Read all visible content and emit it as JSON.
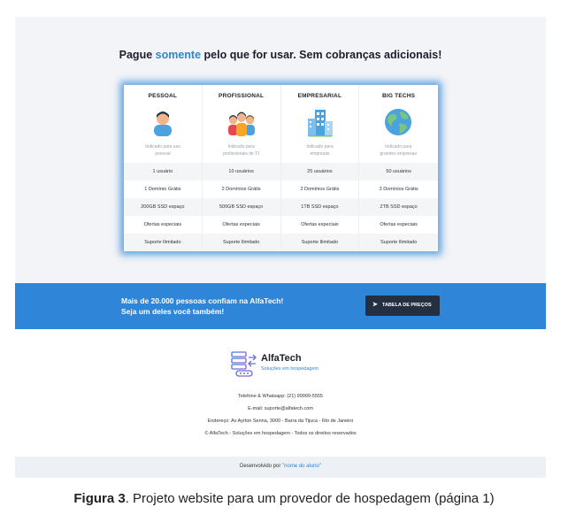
{
  "headline": {
    "part1": "Pague ",
    "highlight": "somente",
    "part2": " pelo que for usar. Sem cobranças adicionais!"
  },
  "plans": [
    {
      "name": "PESSOAL",
      "icon": "person-icon",
      "desc1": "Indicado para uso",
      "desc2": "pessoal",
      "features": [
        "1 usuário",
        "1 Domínio Grátis",
        "200GB SSD espaço",
        "Ofertas especiais",
        "Suporte Ilimitado"
      ]
    },
    {
      "name": "PROFISSIONAL",
      "icon": "team-icon",
      "desc1": "Indicado para",
      "desc2": "profissionais de T.I",
      "features": [
        "10 usuários",
        "2 Domínios Grátis",
        "500GB SSD espaço",
        "Ofertas especiais",
        "Suporte Ilimitado"
      ]
    },
    {
      "name": "EMPRESARIAL",
      "icon": "buildings-icon",
      "desc1": "Indicado para",
      "desc2": "empresas",
      "features": [
        "25 usuários",
        "2 Domínios Grátis",
        "1TB SSD espaço",
        "Ofertas especiais",
        "Suporte Ilimitado"
      ]
    },
    {
      "name": "BIG TECHS",
      "icon": "globe-icon",
      "desc1": "Indicado para",
      "desc2": "grandes empresas",
      "features": [
        "50 usuários",
        "3 Domínios Grátis",
        "2TB SSD espaço",
        "Ofertas especiais",
        "Suporte Ilimitado"
      ]
    }
  ],
  "banner": {
    "line1": "Mais de 20.000 pessoas confiam na AlfaTech!",
    "line2": "Seja um deles você também!",
    "button": "TABELA DE PREÇOS"
  },
  "footer": {
    "brand": "AlfaTech",
    "tagline": "Soluções em hospedagem",
    "phone": "Telefone & Whatsapp: (21) 99999-5555",
    "email": "E-mail: suporte@alfatech.com",
    "address": "Endereço: Av Ayrton Senna, 3000 - Barra da Tijuca - Rio de Janeiro",
    "copyright": "© AlfaTech - Soluções em hospedagem - Todos os direitos reservados"
  },
  "dev": {
    "label": "Desenvolvido por ",
    "name": "\"nome do aluno\""
  },
  "caption": {
    "bold": "Figura 3",
    "rest": ". Projeto website para um provedor de hospedagem (página 1)"
  },
  "colors": {
    "accent": "#2f86d8",
    "button_bg": "#243042",
    "dark_text": "#1d1d2b"
  }
}
